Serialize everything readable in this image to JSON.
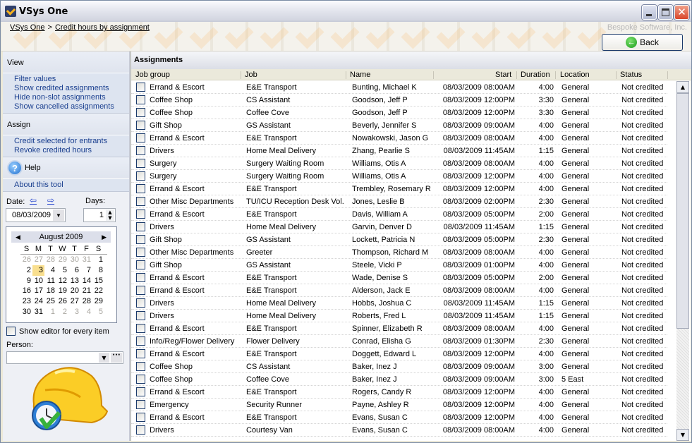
{
  "window": {
    "title": "VSys One",
    "minimize_label": "_",
    "maximize_label": "□",
    "close_label": "✕"
  },
  "breadcrumb": {
    "items": [
      "VSys One",
      "Credit hours by assignment"
    ],
    "separator": ">"
  },
  "vendor": "Bespoke Software, Inc.",
  "back_button": {
    "label": "Back",
    "icon": "back-arrow-icon",
    "icon_glyph": "←"
  },
  "sidebar": {
    "view": {
      "heading": "View",
      "links": [
        "Filter values",
        "Show credited assignments",
        "Hide non-slot assignments",
        "Show cancelled assignments"
      ]
    },
    "assign": {
      "heading": "Assign",
      "links": [
        "Credit selected for entrants",
        "Revoke credited hours"
      ]
    },
    "help": {
      "heading": "Help",
      "icon_glyph": "?",
      "links": [
        "About this tool"
      ]
    },
    "date_label": "Date:",
    "prev_arrow": "⇦",
    "next_arrow": "⇨",
    "days_label": "Days:",
    "date_value": "08/03/2009",
    "days_value": "1",
    "calendar": {
      "month_label": "August 2009",
      "prev": "◀",
      "next": "▶",
      "dow": [
        "S",
        "M",
        "T",
        "W",
        "T",
        "F",
        "S"
      ],
      "weeks": [
        [
          {
            "d": "26",
            "o": true
          },
          {
            "d": "27",
            "o": true
          },
          {
            "d": "28",
            "o": true
          },
          {
            "d": "29",
            "o": true
          },
          {
            "d": "30",
            "o": true
          },
          {
            "d": "31",
            "o": true
          },
          {
            "d": "1"
          }
        ],
        [
          {
            "d": "2"
          },
          {
            "d": "3",
            "sel": true
          },
          {
            "d": "4"
          },
          {
            "d": "5"
          },
          {
            "d": "6"
          },
          {
            "d": "7"
          },
          {
            "d": "8"
          }
        ],
        [
          {
            "d": "9"
          },
          {
            "d": "10"
          },
          {
            "d": "11"
          },
          {
            "d": "12"
          },
          {
            "d": "13"
          },
          {
            "d": "14"
          },
          {
            "d": "15"
          }
        ],
        [
          {
            "d": "16"
          },
          {
            "d": "17"
          },
          {
            "d": "18"
          },
          {
            "d": "19"
          },
          {
            "d": "20"
          },
          {
            "d": "21"
          },
          {
            "d": "22"
          }
        ],
        [
          {
            "d": "23"
          },
          {
            "d": "24"
          },
          {
            "d": "25"
          },
          {
            "d": "26"
          },
          {
            "d": "27"
          },
          {
            "d": "28"
          },
          {
            "d": "29"
          }
        ],
        [
          {
            "d": "30"
          },
          {
            "d": "31"
          },
          {
            "d": "1",
            "o": true
          },
          {
            "d": "2",
            "o": true
          },
          {
            "d": "3",
            "o": true
          },
          {
            "d": "4",
            "o": true
          },
          {
            "d": "5",
            "o": true
          }
        ]
      ]
    },
    "editor_checkbox_label": "Show editor for every item",
    "editor_checked": false,
    "person_label": "Person:",
    "person_value": "",
    "person_more": "···",
    "mascot_icon": "hard-hat-clock-check-icon"
  },
  "main": {
    "title": "Assignments",
    "columns": [
      "Job group",
      "Job",
      "Name",
      "Start",
      "Duration",
      "Location",
      "Status"
    ],
    "rows": [
      [
        "Errand & Escort",
        "E&E Transport",
        "Bunting, Michael K",
        "08/03/2009 08:00AM",
        "4:00",
        "General",
        "Not credited"
      ],
      [
        "Coffee Shop",
        "CS Assistant",
        "Goodson, Jeff P",
        "08/03/2009 12:00PM",
        "3:30",
        "General",
        "Not credited"
      ],
      [
        "Coffee Shop",
        "Coffee Cove",
        "Goodson, Jeff P",
        "08/03/2009 12:00PM",
        "3:30",
        "General",
        "Not credited"
      ],
      [
        "Gift Shop",
        "GS Assistant",
        "Beverly, Jennifer S",
        "08/03/2009 09:00AM",
        "4:00",
        "General",
        "Not credited"
      ],
      [
        "Errand & Escort",
        "E&E Transport",
        "Nowakowski, Jason G",
        "08/03/2009 08:00AM",
        "4:00",
        "General",
        "Not credited"
      ],
      [
        "Drivers",
        "Home Meal Delivery",
        "Zhang, Pearlie S",
        "08/03/2009 11:45AM",
        "1:15",
        "General",
        "Not credited"
      ],
      [
        "Surgery",
        "Surgery Waiting Room",
        "Williams, Otis A",
        "08/03/2009 08:00AM",
        "4:00",
        "General",
        "Not credited"
      ],
      [
        "Surgery",
        "Surgery Waiting Room",
        "Williams, Otis A",
        "08/03/2009 12:00PM",
        "4:00",
        "General",
        "Not credited"
      ],
      [
        "Errand & Escort",
        "E&E Transport",
        "Trembley, Rosemary R",
        "08/03/2009 12:00PM",
        "4:00",
        "General",
        "Not credited"
      ],
      [
        "Other Misc Departments",
        "TU/ICU Reception Desk Vol.",
        "Jones, Leslie B",
        "08/03/2009 02:00PM",
        "2:30",
        "General",
        "Not credited"
      ],
      [
        "Errand & Escort",
        "E&E Transport",
        "Davis, William A",
        "08/03/2009 05:00PM",
        "2:00",
        "General",
        "Not credited"
      ],
      [
        "Drivers",
        "Home Meal Delivery",
        "Garvin, Denver D",
        "08/03/2009 11:45AM",
        "1:15",
        "General",
        "Not credited"
      ],
      [
        "Gift Shop",
        "GS Assistant",
        "Lockett, Patricia N",
        "08/03/2009 05:00PM",
        "2:30",
        "General",
        "Not credited"
      ],
      [
        "Other Misc Departments",
        "Greeter",
        "Thompson, Richard M",
        "08/03/2009 08:00AM",
        "4:00",
        "General",
        "Not credited"
      ],
      [
        "Gift Shop",
        "GS Assistant",
        "Steele, Vicki P",
        "08/03/2009 01:00PM",
        "4:00",
        "General",
        "Not credited"
      ],
      [
        "Errand & Escort",
        "E&E Transport",
        "Wade, Denise S",
        "08/03/2009 05:00PM",
        "2:00",
        "General",
        "Not credited"
      ],
      [
        "Errand & Escort",
        "E&E Transport",
        "Alderson, Jack E",
        "08/03/2009 08:00AM",
        "4:00",
        "General",
        "Not credited"
      ],
      [
        "Drivers",
        "Home Meal Delivery",
        "Hobbs, Joshua C",
        "08/03/2009 11:45AM",
        "1:15",
        "General",
        "Not credited"
      ],
      [
        "Drivers",
        "Home Meal Delivery",
        "Roberts, Fred L",
        "08/03/2009 11:45AM",
        "1:15",
        "General",
        "Not credited"
      ],
      [
        "Errand & Escort",
        "E&E Transport",
        "Spinner, Elizabeth R",
        "08/03/2009 08:00AM",
        "4:00",
        "General",
        "Not credited"
      ],
      [
        "Info/Reg/Flower Delivery",
        "Flower Delivery",
        "Conrad, Elisha G",
        "08/03/2009 01:30PM",
        "2:30",
        "General",
        "Not credited"
      ],
      [
        "Errand & Escort",
        "E&E Transport",
        "Doggett, Edward L",
        "08/03/2009 12:00PM",
        "4:00",
        "General",
        "Not credited"
      ],
      [
        "Coffee Shop",
        "CS Assistant",
        "Baker, Inez J",
        "08/03/2009 09:00AM",
        "3:00",
        "General",
        "Not credited"
      ],
      [
        "Coffee Shop",
        "Coffee Cove",
        "Baker, Inez J",
        "08/03/2009 09:00AM",
        "3:00",
        "5 East",
        "Not credited"
      ],
      [
        "Errand & Escort",
        "E&E Transport",
        "Rogers, Candy R",
        "08/03/2009 12:00PM",
        "4:00",
        "General",
        "Not credited"
      ],
      [
        "Emergency",
        "Security Runner",
        "Payne, Ashley R",
        "08/03/2009 12:00PM",
        "4:00",
        "General",
        "Not credited"
      ],
      [
        "Errand & Escort",
        "E&E Transport",
        "Evans, Susan C",
        "08/03/2009 12:00PM",
        "4:00",
        "General",
        "Not credited"
      ],
      [
        "Drivers",
        "Courtesy Van",
        "Evans, Susan C",
        "08/03/2009 08:00AM",
        "4:00",
        "General",
        "Not credited"
      ]
    ],
    "scroll_up": "▲",
    "scroll_down": "▼"
  },
  "colors": {
    "link": "#1a3f8f",
    "selected_day": "#f9df8f",
    "header_bg": "#ebe9db"
  }
}
